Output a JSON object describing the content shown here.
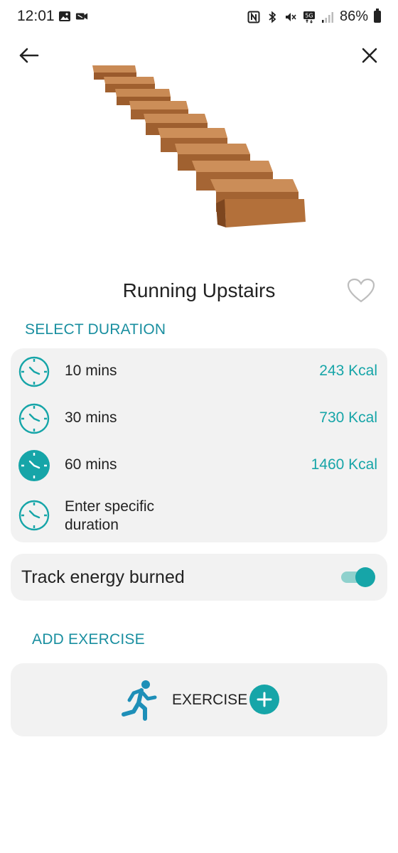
{
  "status_bar": {
    "time": "12:01",
    "battery": "86%",
    "network": "5G",
    "icons": [
      "image-icon",
      "video-icon",
      "nfc-icon",
      "bluetooth-icon",
      "mute-icon",
      "signal-icon",
      "battery-icon"
    ]
  },
  "nav": {
    "back_icon": "arrow-left-icon",
    "close_icon": "close-icon"
  },
  "hero": {
    "icon": "wooden-stairs-image"
  },
  "exercise": {
    "title": "Running Upstairs",
    "favorite_icon": "heart-outline-icon"
  },
  "duration": {
    "section_label": "SELECT DURATION",
    "options": [
      {
        "label": "10 mins",
        "kcal": "243 Kcal",
        "selected": false
      },
      {
        "label": "30 mins",
        "kcal": "730 Kcal",
        "selected": false
      },
      {
        "label": "60 mins",
        "kcal": "1460 Kcal",
        "selected": true
      },
      {
        "label": "Enter specific duration",
        "kcal": "",
        "selected": false
      }
    ]
  },
  "track": {
    "label": "Track energy burned",
    "enabled": true
  },
  "add_exercise": {
    "section_label": "ADD EXERCISE",
    "button_label": "EXERCISE",
    "runner_icon": "runner-icon",
    "plus_icon": "plus-icon"
  },
  "colors": {
    "accent": "#16a5a8",
    "section_label": "#1a8fa0",
    "card_bg": "#f2f2f2"
  }
}
